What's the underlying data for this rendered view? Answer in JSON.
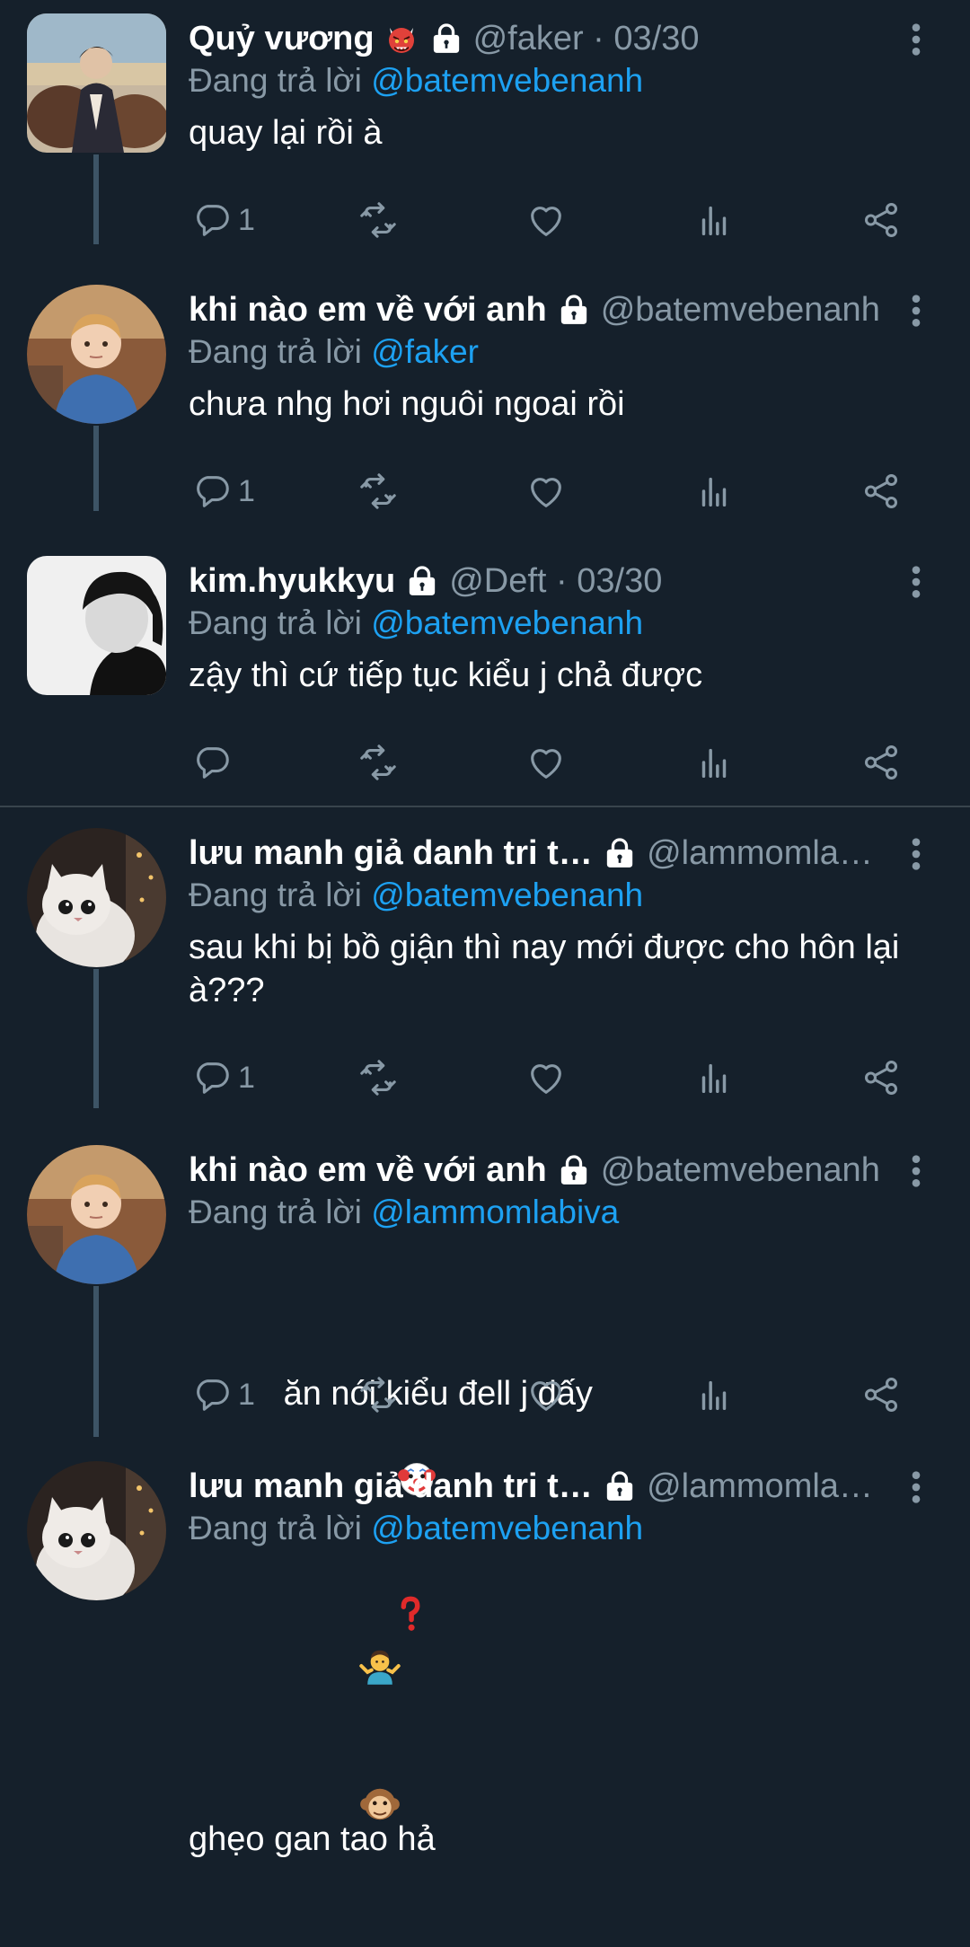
{
  "tweets": [
    {
      "name": "Quỷ vương",
      "has_name_emoji": true,
      "handle": "@faker · 03/30",
      "reply_prefix": "Đang trả lời",
      "reply_to": "@batemvebenanh",
      "text": "quay lại rồi à",
      "reply_count": "1"
    },
    {
      "name": "khi nào em về với anh",
      "handle": "@batemvebenanh",
      "reply_prefix": "Đang trả lời",
      "reply_to": "@faker",
      "text": "chưa nhg hơi nguôi ngoai rồi",
      "reply_count": "1"
    },
    {
      "name": "kim.hyukkyu",
      "handle": "@Deft · 03/30",
      "reply_prefix": "Đang trả lời",
      "reply_to": "@batemvebenanh",
      "text": "zậy thì cứ tiếp tục kiểu j chả được",
      "reply_count": ""
    },
    {
      "name": "lưu manh giả danh tri thức",
      "handle": "@lammomlabiva",
      "reply_prefix": "Đang trả lời",
      "reply_to": "@batemvebenanh",
      "text": "sau khi bị bồ giận thì nay mới được cho hôn lại à???",
      "reply_count": "1"
    },
    {
      "name": "khi nào em về với anh",
      "handle": "@batemvebenanh",
      "reply_prefix": "Đang trả lời",
      "reply_to": "@lammomlabiva",
      "text_line1": "ăn nói kiểu đell j đấy",
      "text_emojis": [
        "clown-face",
        "red-question-mark"
      ],
      "text_line2": "ghẹo gan tao hả",
      "reply_count": "1"
    },
    {
      "name": "lưu manh giả danh tri thức",
      "handle": "@lammomlabiva",
      "reply_prefix": "Đang trả lời",
      "reply_to": "@batemvebenanh",
      "text_emojis": [
        "person-shrugging",
        "monkey-face"
      ]
    }
  ],
  "colors": {
    "background": "#15202b",
    "secondary_text": "#8899a6",
    "link": "#1da1f2",
    "divider": "#38444d",
    "thread_line": "#3d5466"
  },
  "icons": [
    "reply-icon",
    "retweet-icon",
    "like-icon",
    "stats-icon",
    "share-icon",
    "more-icon",
    "lock-icon"
  ]
}
